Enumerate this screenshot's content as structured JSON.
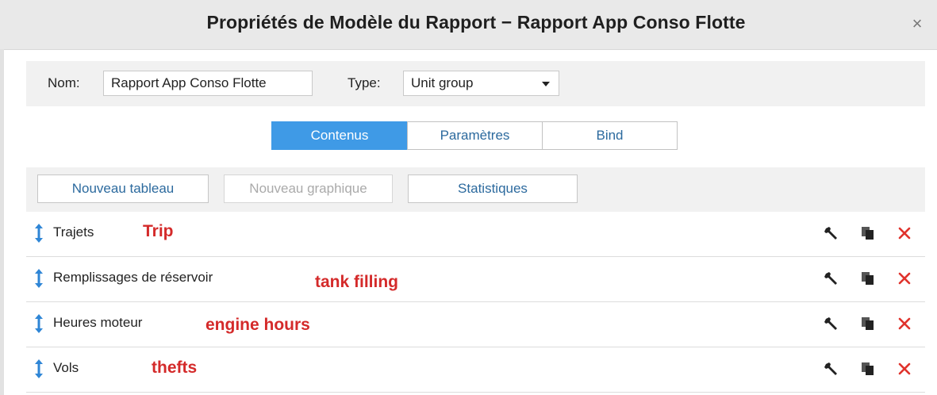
{
  "dialog": {
    "title": "Propriétés de Modèle du Rapport − Rapport App Conso Flotte",
    "close_glyph": "×"
  },
  "form": {
    "name_label": "Nom:",
    "name_value": "Rapport App Conso Flotte",
    "type_label": "Type:",
    "type_value": "Unit group"
  },
  "tabs": [
    {
      "label": "Contenus",
      "active": true
    },
    {
      "label": "Paramètres",
      "active": false
    },
    {
      "label": "Bind",
      "active": false
    }
  ],
  "toolbar": {
    "new_table": "Nouveau tableau",
    "new_chart": "Nouveau graphique",
    "statistics": "Statistiques"
  },
  "rows": [
    {
      "label": "Trajets",
      "note": "Trip"
    },
    {
      "label": "Remplissages de réservoir",
      "note": "tank filling"
    },
    {
      "label": "Heures moteur",
      "note": "engine hours"
    },
    {
      "label": "Vols",
      "note": "thefts"
    }
  ],
  "icons": {
    "drag": "vertical-arrows-icon",
    "edit": "wrench-icon",
    "copy": "copy-icon",
    "delete": "delete-icon"
  },
  "colors": {
    "accent": "#3f9ae6",
    "link": "#2c6a9e",
    "annotation": "#d42a2a",
    "delete": "#e0332c"
  }
}
